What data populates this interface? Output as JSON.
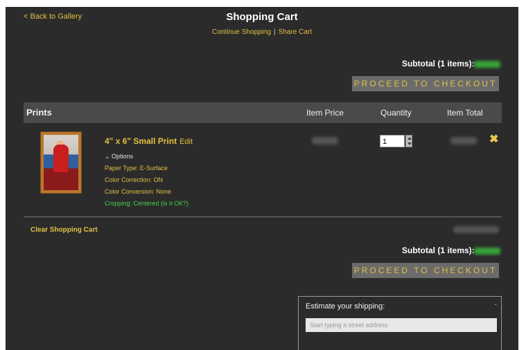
{
  "header": {
    "back_link": "< Back to Gallery",
    "title": "Shopping Cart",
    "continue_link": "Continue Shopping",
    "separator": "|",
    "share_link": "Share Cart"
  },
  "summary": {
    "subtotal_label": "Subtotal (1 items):",
    "checkout_label": "PROCEED TO CHECKOUT"
  },
  "table": {
    "section_label": "Prints",
    "columns": [
      "Item Price",
      "Quantity",
      "Item Total"
    ]
  },
  "item": {
    "name": "4\" x 6\" Small Print",
    "edit_label": "Edit",
    "options_toggle": "⌄ Options",
    "options": [
      "Paper Type: E-Surface",
      "Color Correction: ON",
      "Color Conversion: None",
      "Cropping: Centered (is it OK?)"
    ],
    "quantity": "1",
    "remove_icon": "✖"
  },
  "footer": {
    "clear_cart": "Clear Shopping Cart"
  },
  "shipping": {
    "title": "Estimate your shipping:",
    "collapse": "-",
    "placeholder": "Start typing a street address"
  },
  "colors": {
    "background": "#2b2b2b",
    "accent": "#e2c044",
    "cropping_green": "#49d04b",
    "button_bg": "#6b6b6b"
  }
}
